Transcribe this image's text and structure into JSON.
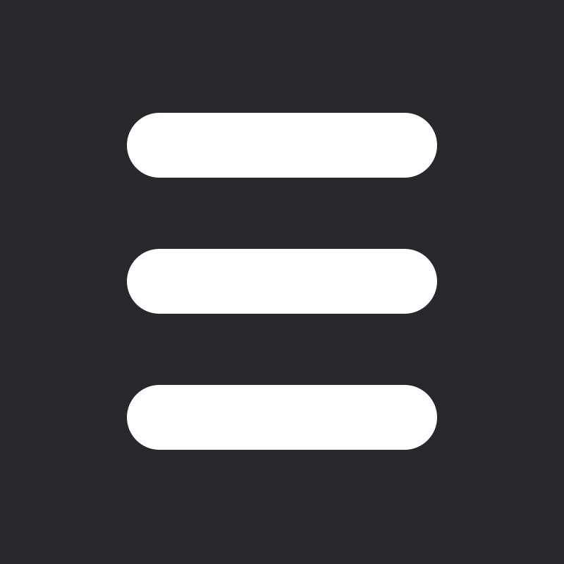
{
  "menu_button": {
    "icon": "hamburger-menu-icon",
    "bar_count": 3,
    "colors": {
      "background": "#27282c",
      "icon": "#ffffff"
    }
  }
}
